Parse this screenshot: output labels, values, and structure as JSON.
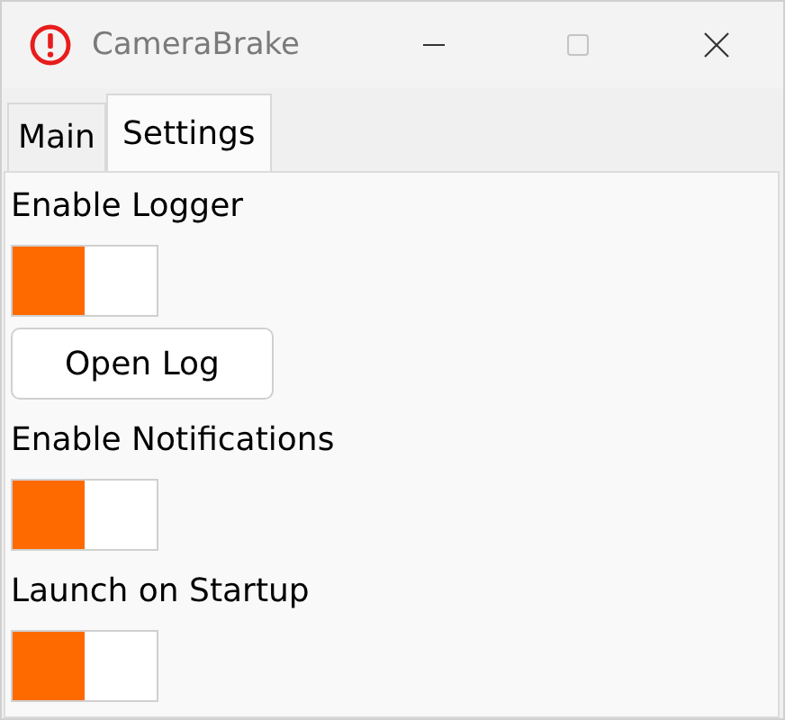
{
  "window": {
    "title": "CameraBrake",
    "maximize_disabled": true
  },
  "tabs": [
    {
      "label": "Main",
      "selected": false
    },
    {
      "label": "Settings",
      "selected": true
    }
  ],
  "settings": [
    {
      "kind": "label",
      "text": "Enable Logger"
    },
    {
      "kind": "toggle",
      "on": true
    },
    {
      "kind": "button",
      "text": "Open Log"
    },
    {
      "kind": "label",
      "text": "Enable Notifications"
    },
    {
      "kind": "toggle",
      "on": true
    },
    {
      "kind": "label",
      "text": "Launch on Startup"
    },
    {
      "kind": "toggle",
      "on": true
    }
  ]
}
